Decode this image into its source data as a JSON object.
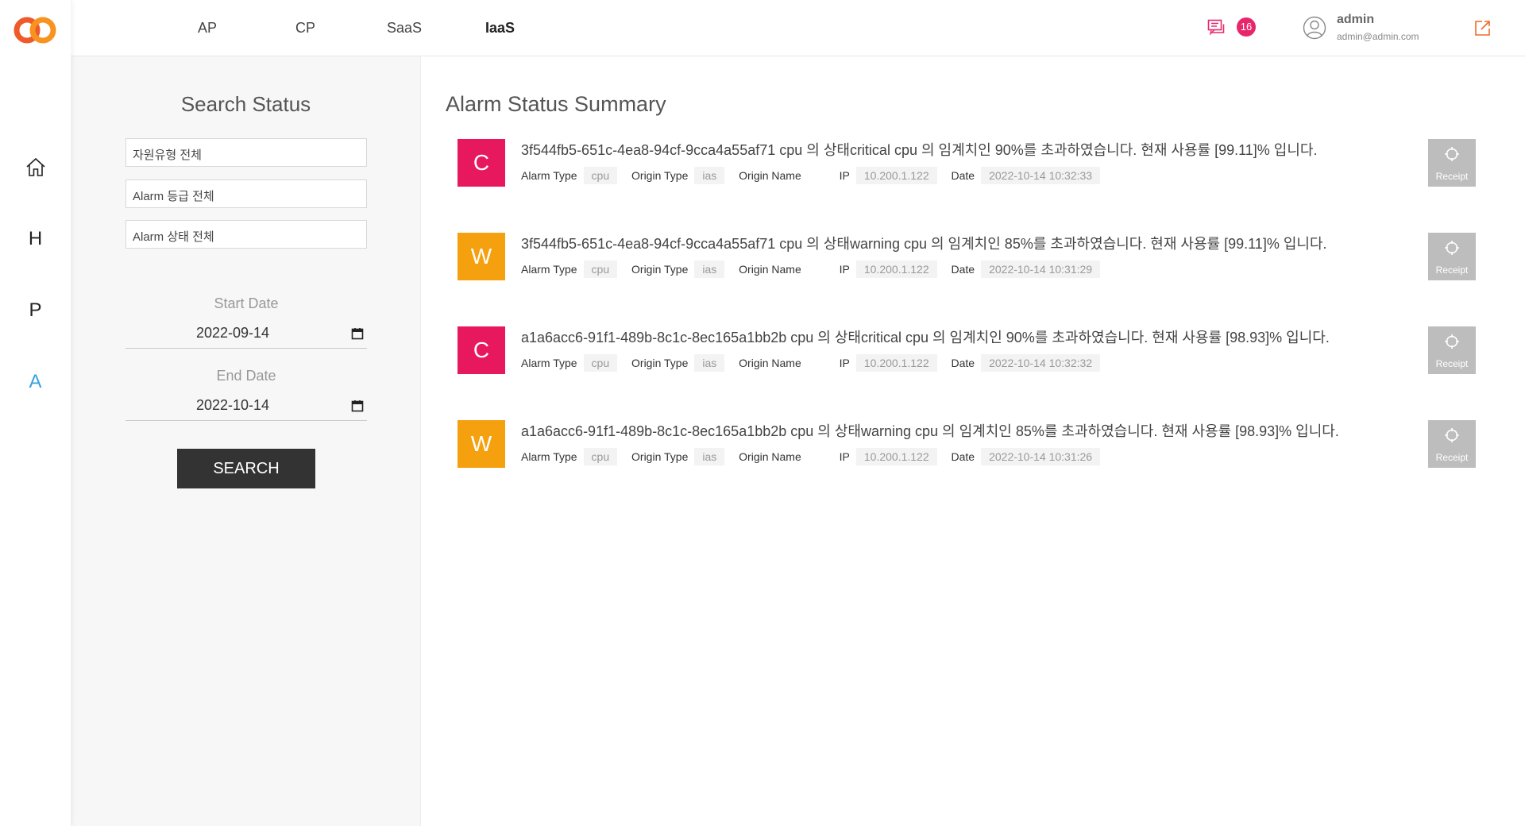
{
  "colors": {
    "accent": "#3aa0e0",
    "critical": "#e8185f",
    "warning": "#f5a00f",
    "badge": "#e8266b",
    "search_button": "#333333",
    "receipt_button": "#bdbdbd"
  },
  "sidebar": {
    "items": [
      {
        "icon": "home-icon"
      },
      {
        "label": "H"
      },
      {
        "label": "P"
      },
      {
        "label": "A",
        "active": true
      }
    ]
  },
  "header": {
    "tabs": [
      {
        "label": "AP"
      },
      {
        "label": "CP"
      },
      {
        "label": "SaaS"
      },
      {
        "label": "IaaS",
        "active": true
      }
    ],
    "notification_count": "16",
    "user": {
      "name": "admin",
      "email": "admin@admin.com"
    }
  },
  "search": {
    "title": "Search Status",
    "filters": [
      "자원유형 전체",
      "Alarm 등급 전체",
      "Alarm 상태 전체"
    ],
    "start_label": "Start Date",
    "start_value": "2022-09-14",
    "end_label": "End Date",
    "end_value": "2022-10-14",
    "button": "SEARCH"
  },
  "main": {
    "title": "Alarm Status Summary",
    "meta_labels": {
      "alarm_type": "Alarm Type",
      "origin_type": "Origin Type",
      "origin_name": "Origin Name",
      "ip": "IP",
      "date": "Date"
    },
    "receipt_label": "Receipt",
    "alarms": [
      {
        "level": "C",
        "message": "3f544fb5-651c-4ea8-94cf-9cca4a55af71 cpu 의 상태critical cpu 의 임계치인 90%를 초과하였습니다. 현재 사용률 [99.11]% 입니다.",
        "alarm_type": "cpu",
        "origin_type": "ias",
        "ip": "10.200.1.122",
        "date": "2022-10-14 10:32:33"
      },
      {
        "level": "W",
        "message": "3f544fb5-651c-4ea8-94cf-9cca4a55af71 cpu 의 상태warning cpu 의 임계치인 85%를 초과하였습니다. 현재 사용률 [99.11]% 입니다.",
        "alarm_type": "cpu",
        "origin_type": "ias",
        "ip": "10.200.1.122",
        "date": "2022-10-14 10:31:29"
      },
      {
        "level": "C",
        "message": "a1a6acc6-91f1-489b-8c1c-8ec165a1bb2b cpu 의 상태critical cpu 의 임계치인 90%를 초과하였습니다. 현재 사용률 [98.93]% 입니다.",
        "alarm_type": "cpu",
        "origin_type": "ias",
        "ip": "10.200.1.122",
        "date": "2022-10-14 10:32:32"
      },
      {
        "level": "W",
        "message": "a1a6acc6-91f1-489b-8c1c-8ec165a1bb2b cpu 의 상태warning cpu 의 임계치인 85%를 초과하였습니다. 현재 사용률 [98.93]% 입니다.",
        "alarm_type": "cpu",
        "origin_type": "ias",
        "ip": "10.200.1.122",
        "date": "2022-10-14 10:31:26"
      }
    ]
  }
}
